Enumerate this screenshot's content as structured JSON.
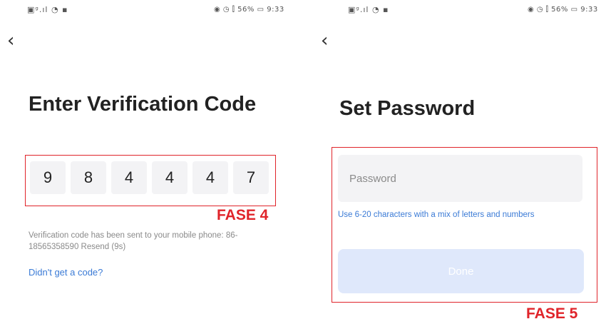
{
  "left_screen": {
    "status": {
      "left_icons": "▣ᵍ.ıl ◔ ▪",
      "right_icons": "◉ ◷ ⫿ 56% ▭ 9:33"
    },
    "back_icon": "‹",
    "title": "Enter Verification Code",
    "code_digits": [
      "9",
      "8",
      "4",
      "4",
      "4",
      "7"
    ],
    "phase_label": "FASE 4",
    "info_text": "Verification code has been sent to your mobile phone: 86-18565358590 Resend (9s)",
    "help_link": "Didn't get a code?"
  },
  "right_screen": {
    "status": {
      "left_icons": "▣ᵍ.ıl ◔ ▪",
      "right_icons": "◉ ◷ ⫿ 56% ▭ 9:33"
    },
    "back_icon": "‹",
    "title": "Set Password",
    "password_placeholder": "Password",
    "hint": "Use 6-20 characters with a mix of letters and numbers",
    "done_label": "Done",
    "phase_label": "FASE 5"
  },
  "colors": {
    "highlight": "#e0242a",
    "link": "#3b7bd6",
    "button_disabled_bg": "#dfe8fb",
    "input_bg": "#f3f3f5"
  }
}
